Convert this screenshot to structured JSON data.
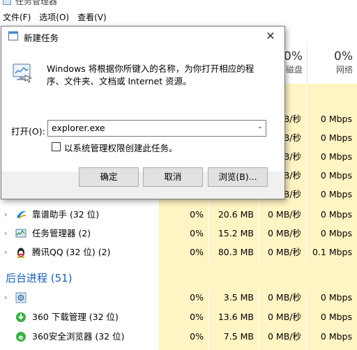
{
  "task_manager": {
    "title": "任务管理器",
    "menu": [
      "文件(F)",
      "选项(O)",
      "查看(V)"
    ],
    "columns": {
      "disk": {
        "percent": "0%",
        "label": "磁盘"
      },
      "network": {
        "percent": "0%",
        "label": "网络"
      }
    },
    "partial_rows": [
      {
        "disk": "0 MB/秒",
        "net": "0 Mbps"
      },
      {
        "disk": "0 MB/秒",
        "net": "0 Mbps"
      },
      {
        "disk": "0 MB/秒",
        "net": "0 Mbps"
      },
      {
        "disk": "0 MB/秒",
        "net": "0 Mbps"
      },
      {
        "disk": "0 MB/秒",
        "net": "0 Mbps"
      }
    ],
    "apps": [
      {
        "name": "靠谱助手 (32 位)",
        "cpu": "0%",
        "mem": "20.6 MB",
        "disk": "0 MB/秒",
        "net": "0 Mbps",
        "icon": "kaopu-icon"
      },
      {
        "name": "任务管理器 (2)",
        "cpu": "0%",
        "mem": "15.2 MB",
        "disk": "0 MB/秒",
        "net": "0 Mbps",
        "icon": "taskmanager-icon"
      },
      {
        "name": "腾讯QQ (32 位) (2)",
        "cpu": "0%",
        "mem": "80.3 MB",
        "disk": "0 MB/秒",
        "net": "0.1 Mbps",
        "icon": "qq-penguin-icon"
      }
    ],
    "background_section": "后台进程 (51)",
    "background": [
      {
        "name": "",
        "cpu": "0%",
        "mem": "3.5 MB",
        "disk": "0 MB/秒",
        "net": "0 Mbps",
        "icon": "gear-process-icon"
      },
      {
        "name": "360 下载管理 (32 位)",
        "cpu": "0%",
        "mem": "13.6 MB",
        "disk": "0 MB/秒",
        "net": "0 Mbps",
        "icon": "download-360-icon"
      },
      {
        "name": "360安全浏览器 (32 位)",
        "cpu": "0%",
        "mem": "7.5 MB",
        "disk": "0 MB/秒",
        "net": "0 Mbps",
        "icon": "browser-360-icon"
      }
    ]
  },
  "dialog": {
    "title": "新建任务",
    "close_glyph": "✕",
    "description": "Windows 将根据你所键入的名称，为你打开相应的程序、文件夹、文档或 Internet 资源。",
    "open_label": "打开(O):",
    "open_value": "explorer.exe",
    "admin_label": "以系统管理权限创建此任务。",
    "admin_checked": false,
    "buttons": {
      "ok": "确定",
      "cancel": "取消",
      "browse": "浏览(B)..."
    }
  }
}
